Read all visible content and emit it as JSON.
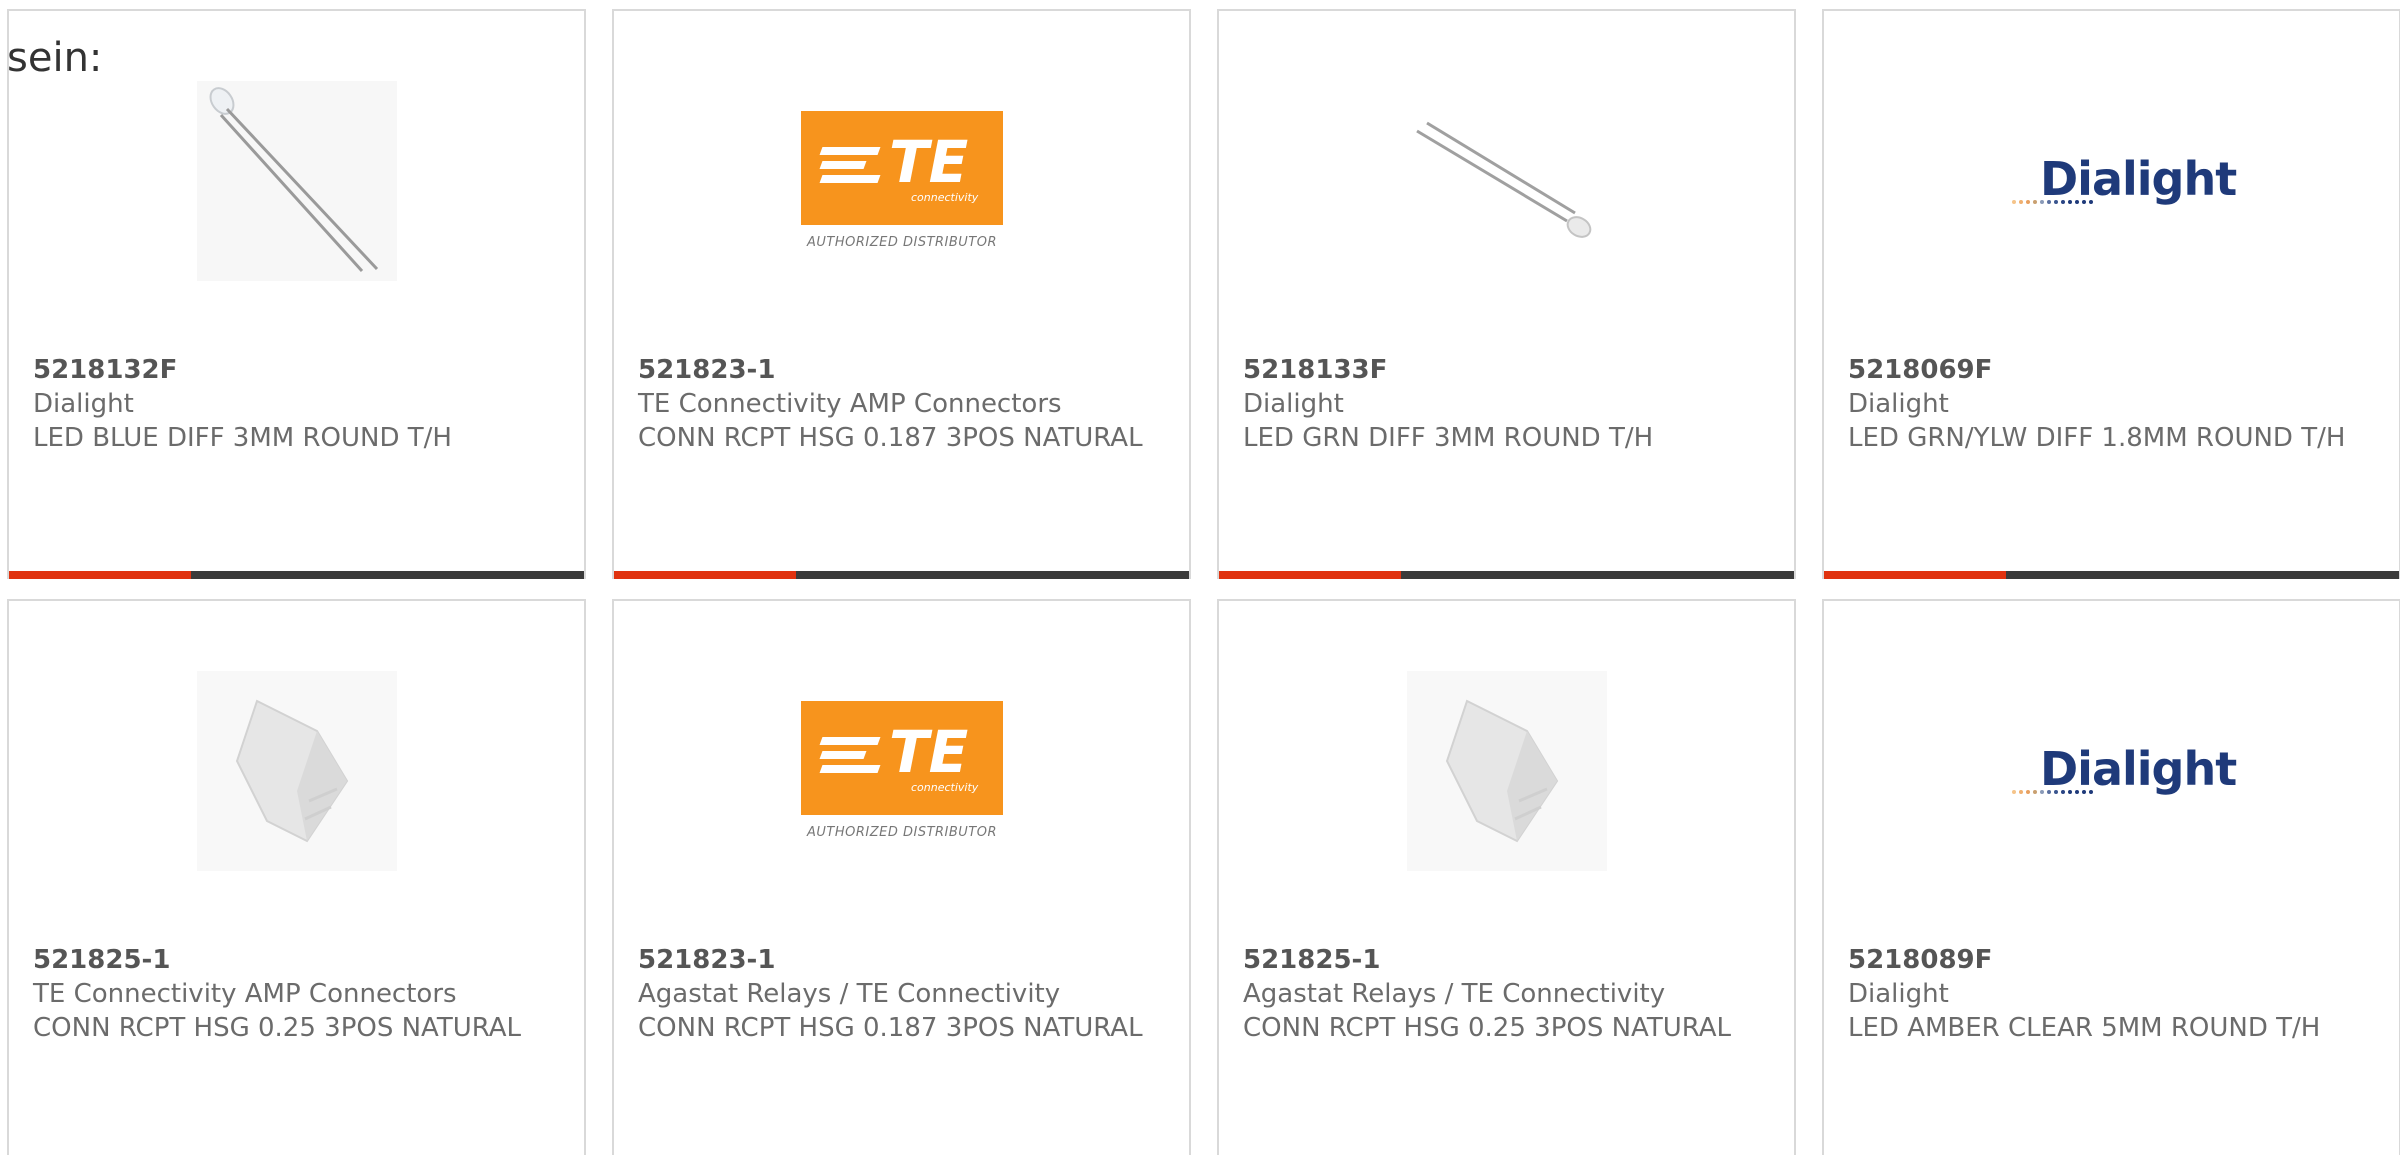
{
  "intro_text": "sein:",
  "colors": {
    "accent": "#e0320f",
    "bar": "#3a3a3a",
    "te_orange": "#f7941d",
    "dialight_blue": "#1f3a7a"
  },
  "te_logo": {
    "brand": "TE",
    "sub": "connectivity",
    "tagline": "AUTHORIZED DISTRIBUTOR"
  },
  "dialight_logo": {
    "brand": "Dialight"
  },
  "products": [
    {
      "image": "led-blue-image",
      "part_number": "5218132F",
      "manufacturer": "Dialight",
      "description": "LED BLUE DIFF 3MM ROUND T/H"
    },
    {
      "image": "te-logo",
      "part_number": "521823-1",
      "manufacturer": "TE Connectivity AMP Connectors",
      "description": "CONN RCPT HSG 0.187 3POS NATURAL"
    },
    {
      "image": "led-green-image",
      "part_number": "5218133F",
      "manufacturer": "Dialight",
      "description": "LED GRN DIFF 3MM ROUND T/H"
    },
    {
      "image": "dialight-logo",
      "part_number": "5218069F",
      "manufacturer": "Dialight",
      "description": "LED GRN/YLW DIFF 1.8MM ROUND T/H"
    },
    {
      "image": "connector-housing-image",
      "part_number": "521825-1",
      "manufacturer": "TE Connectivity AMP Connectors",
      "description": "CONN RCPT HSG 0.25 3POS NATURAL"
    },
    {
      "image": "te-logo",
      "part_number": "521823-1",
      "manufacturer": "Agastat Relays / TE Connectivity",
      "description": "CONN RCPT HSG 0.187 3POS NATURAL"
    },
    {
      "image": "connector-housing-image",
      "part_number": "521825-1",
      "manufacturer": "Agastat Relays / TE Connectivity",
      "description": "CONN RCPT HSG 0.25 3POS NATURAL"
    },
    {
      "image": "dialight-logo",
      "part_number": "5218089F",
      "manufacturer": "Dialight",
      "description": "LED AMBER CLEAR 5MM ROUND T/H"
    }
  ]
}
